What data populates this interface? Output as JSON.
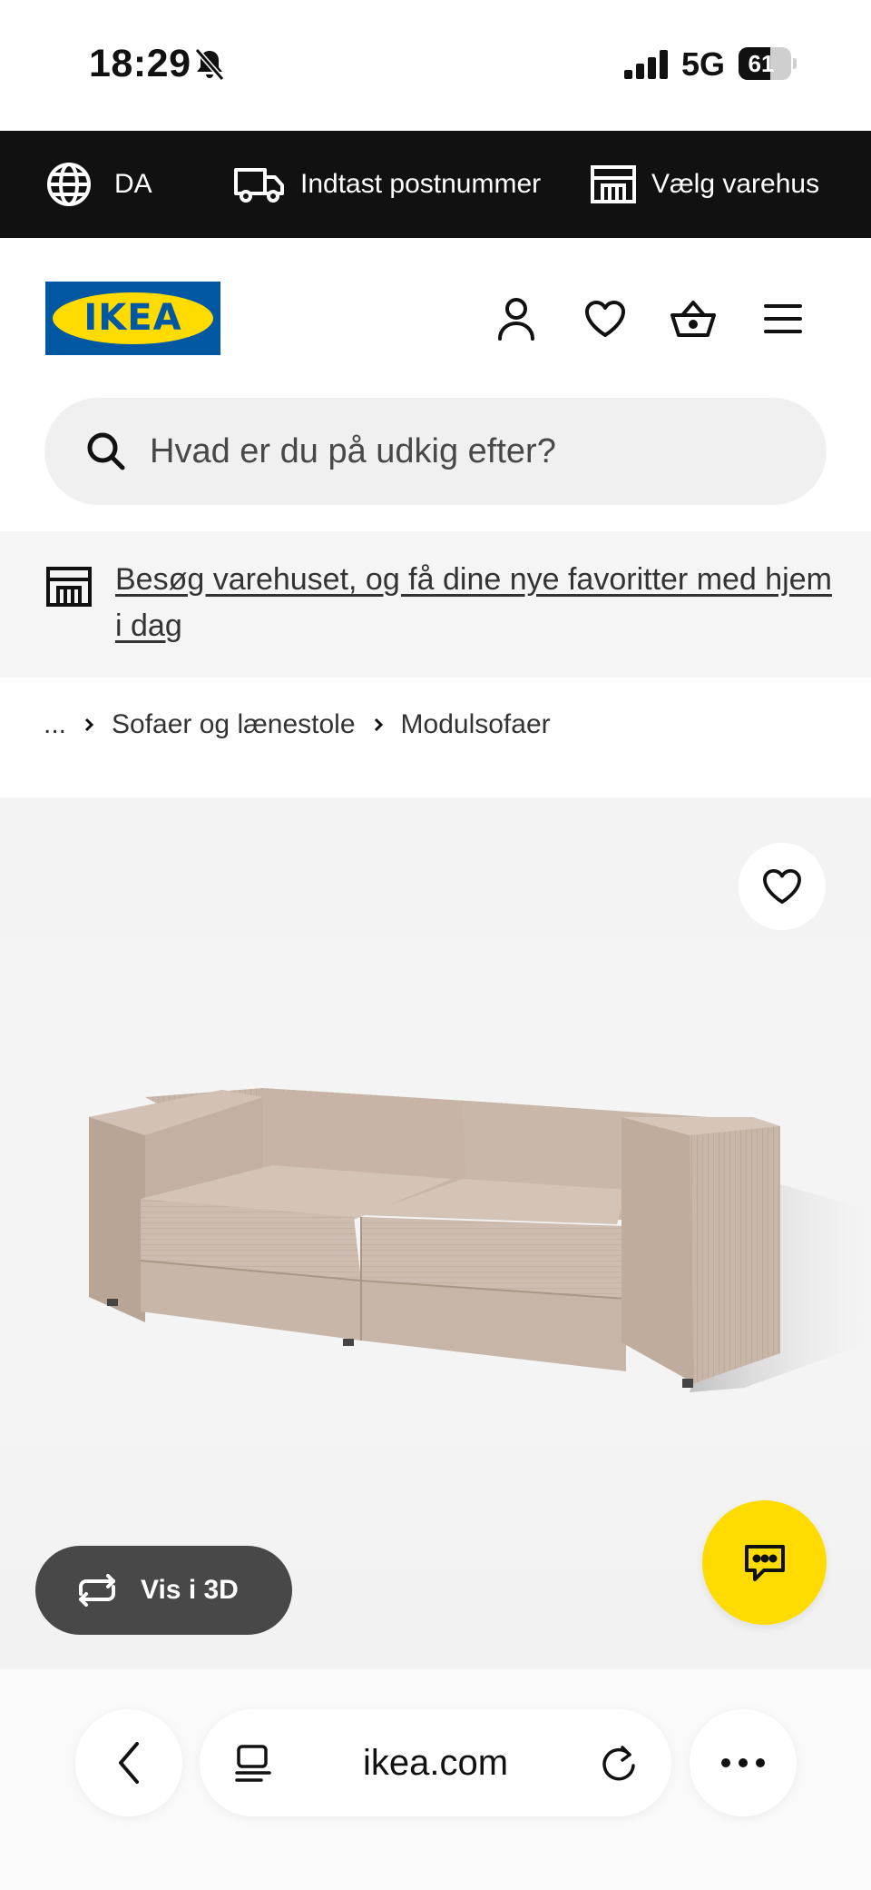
{
  "status_bar": {
    "time": "18:29",
    "network": "5G",
    "battery_percent": 61,
    "battery_label": "61",
    "icons": [
      "bell-muted-icon",
      "signal-icon",
      "battery-icon"
    ]
  },
  "utility_bar": {
    "language": "DA",
    "postal_label": "Indtast postnummer",
    "store_label": "Vælg varehus",
    "icons": [
      "globe-icon",
      "truck-icon",
      "store-icon"
    ]
  },
  "header": {
    "logo_text": "IKEA",
    "icons": [
      "user-icon",
      "heart-icon",
      "basket-icon",
      "menu-icon"
    ]
  },
  "search": {
    "placeholder": "Hvad er du på udkig efter?"
  },
  "banner": {
    "text": "Besøg varehuset, og få dine nye favoritter med hjem i dag"
  },
  "breadcrumb": {
    "items": [
      "...",
      "Sofaer og lænestole",
      "Modulsofaer"
    ]
  },
  "product": {
    "view_3d_label": "Vis i 3D"
  },
  "browser": {
    "url": "ikea.com"
  },
  "colors": {
    "ikea_blue": "#0058a3",
    "ikea_yellow": "#ffdb00",
    "util_bar": "#111111",
    "button_dark": "#484848"
  }
}
